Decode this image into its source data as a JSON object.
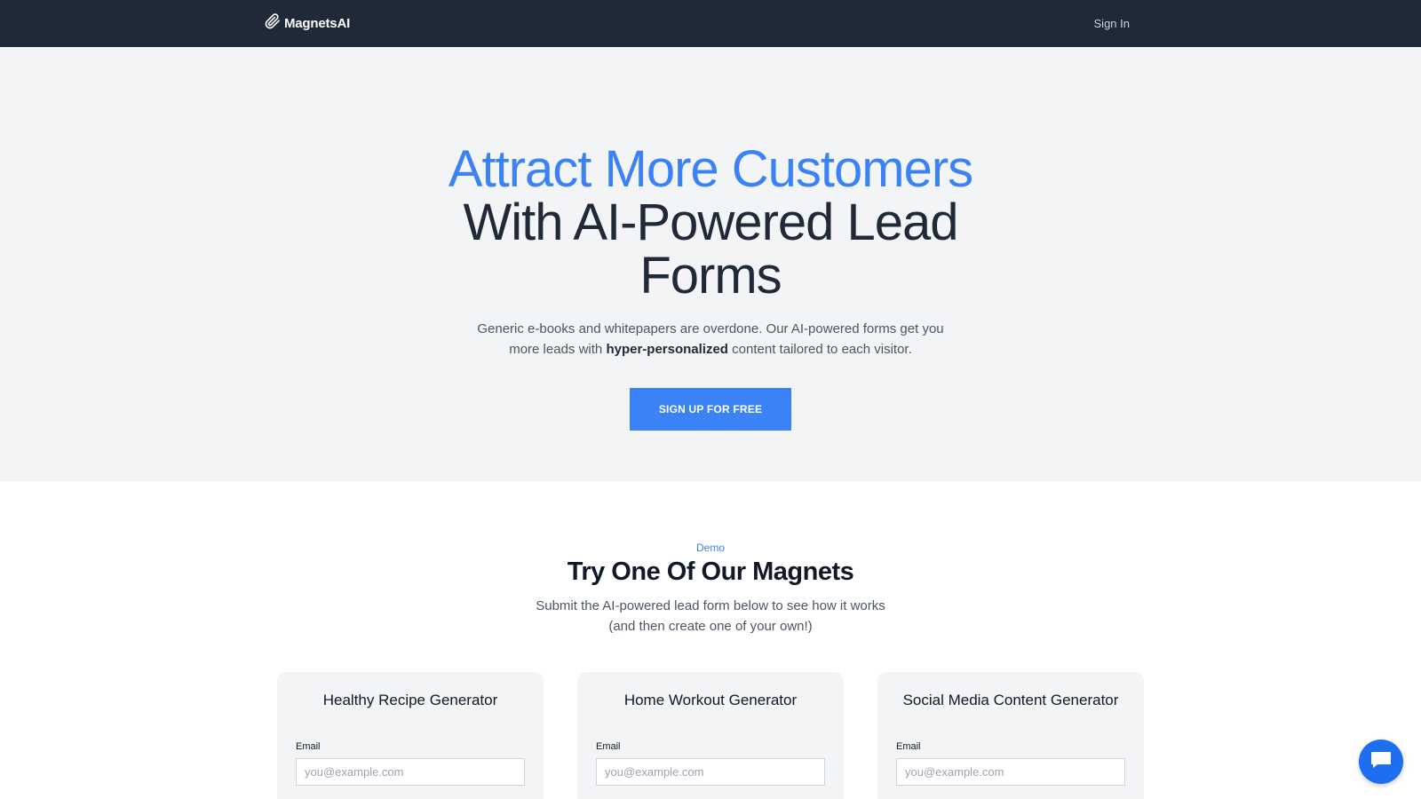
{
  "nav": {
    "brand_name": "MagnetsAI",
    "brand_icon": "paperclip-icon",
    "signin_label": "Sign In"
  },
  "hero": {
    "headline_accent": "Attract More Customers",
    "headline_rest": "With AI-Powered Lead Forms",
    "sub_before": "Generic e-books and whitepapers are overdone. Our AI-powered forms get you more leads with ",
    "sub_bold": "hyper-personalized",
    "sub_after": " content tailored to each visitor.",
    "cta_label": "SIGN UP FOR FREE"
  },
  "demo": {
    "eyebrow": "Demo",
    "title": "Try One Of Our Magnets",
    "subtitle": "Submit the AI-powered lead form below to see how it works (and then create one of your own!)",
    "cards": [
      {
        "title": "Healthy Recipe Generator",
        "email_label": "Email",
        "email_placeholder": "you@example.com",
        "email_value": ""
      },
      {
        "title": "Home Workout Generator",
        "email_label": "Email",
        "email_placeholder": "you@example.com",
        "email_value": ""
      },
      {
        "title": "Social Media Content Generator",
        "email_label": "Email",
        "email_placeholder": "you@example.com",
        "email_value": ""
      }
    ]
  },
  "chat": {
    "icon": "chat-icon"
  },
  "colors": {
    "nav_bg": "#1f2937",
    "accent": "#3b82f6",
    "hero_bg": "#f3f4f6",
    "chat_bg": "#1e6ff0"
  }
}
